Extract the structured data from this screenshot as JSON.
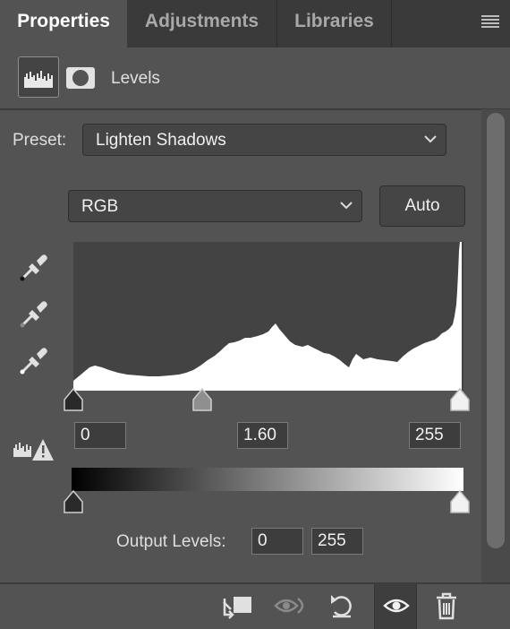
{
  "tabs": [
    {
      "label": "Properties",
      "active": true
    },
    {
      "label": "Adjustments",
      "active": false
    },
    {
      "label": "Libraries",
      "active": false
    }
  ],
  "panel_menu_icon": "hamburger-menu-icon",
  "header": {
    "title": "Levels",
    "layer_icon": "histogram-icon",
    "mask_icon": "mask-icon"
  },
  "preset": {
    "label": "Preset:",
    "value": "Lighten Shadows"
  },
  "channel": {
    "value": "RGB"
  },
  "auto_button": "Auto",
  "eyedroppers": [
    "black-point-eyedropper-icon",
    "gray-point-eyedropper-icon",
    "white-point-eyedropper-icon"
  ],
  "input_levels": {
    "black": "0",
    "gamma": "1.60",
    "white": "255"
  },
  "warning_icon": "histogram-warning-icon",
  "output_levels": {
    "label": "Output Levels:",
    "min": "0",
    "max": "255"
  },
  "footer_icons": [
    "clip-to-layer-icon",
    "view-previous-state-icon",
    "reset-icon",
    "toggle-visibility-icon",
    "delete-icon"
  ],
  "colors": {
    "panel_bg": "#535353",
    "tab_bar_bg": "#3a3a3a",
    "histogram_bg": "#434343",
    "histogram_fill": "#ffffff"
  }
}
